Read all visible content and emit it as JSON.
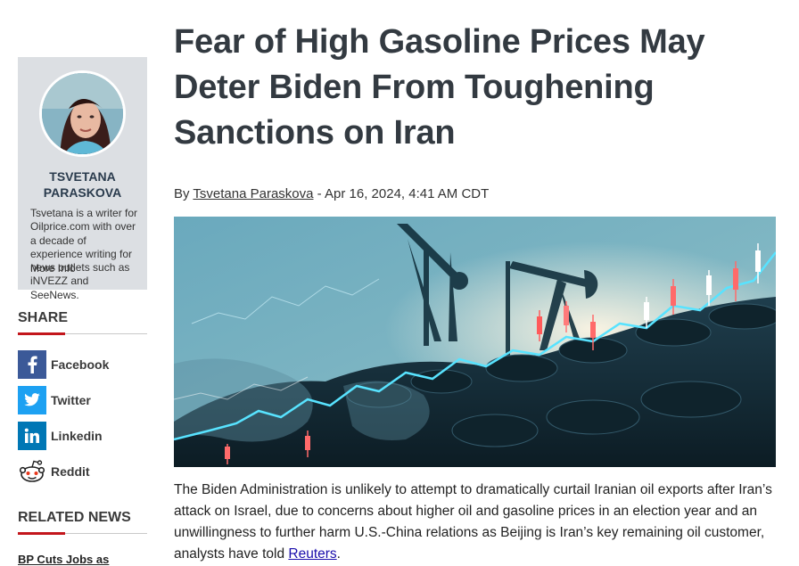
{
  "author": {
    "name_line1": "TSVETANA",
    "name_line2": "PARASKOVA",
    "bio": "Tsvetana is a writer for Oilprice.com with over a decade of experience writing for news outlets such as iNVEZZ and SeeNews.",
    "more_link": "More Info"
  },
  "share": {
    "heading": "SHARE",
    "items": [
      {
        "label": "Facebook",
        "icon": "facebook-icon"
      },
      {
        "label": "Twitter",
        "icon": "twitter-icon"
      },
      {
        "label": "Linkedin",
        "icon": "linkedin-icon"
      },
      {
        "label": "Reddit",
        "icon": "reddit-icon"
      }
    ]
  },
  "related": {
    "heading": "RELATED NEWS",
    "items": [
      "BP Cuts Jobs as"
    ]
  },
  "article": {
    "headline": "Fear of High Gasoline Prices May Deter Biden From Toughening Sanctions on Iran",
    "byline_prefix": "By",
    "byline_author": "Tsvetana Paraskova",
    "byline_date": "- Apr 16, 2024, 4:41 AM CDT",
    "body_text": "The Biden Administration is unlikely to attempt to dramatically curtail Iranian oil exports after Iran’s attack on Israel, due to concerns about higher oil and gasoline prices in an election year and an unwillingness to further harm U.S.-China relations as Beijing is Iran’s key remaining oil customer, analysts have told",
    "body_link": "Reuters",
    "body_end": "."
  }
}
